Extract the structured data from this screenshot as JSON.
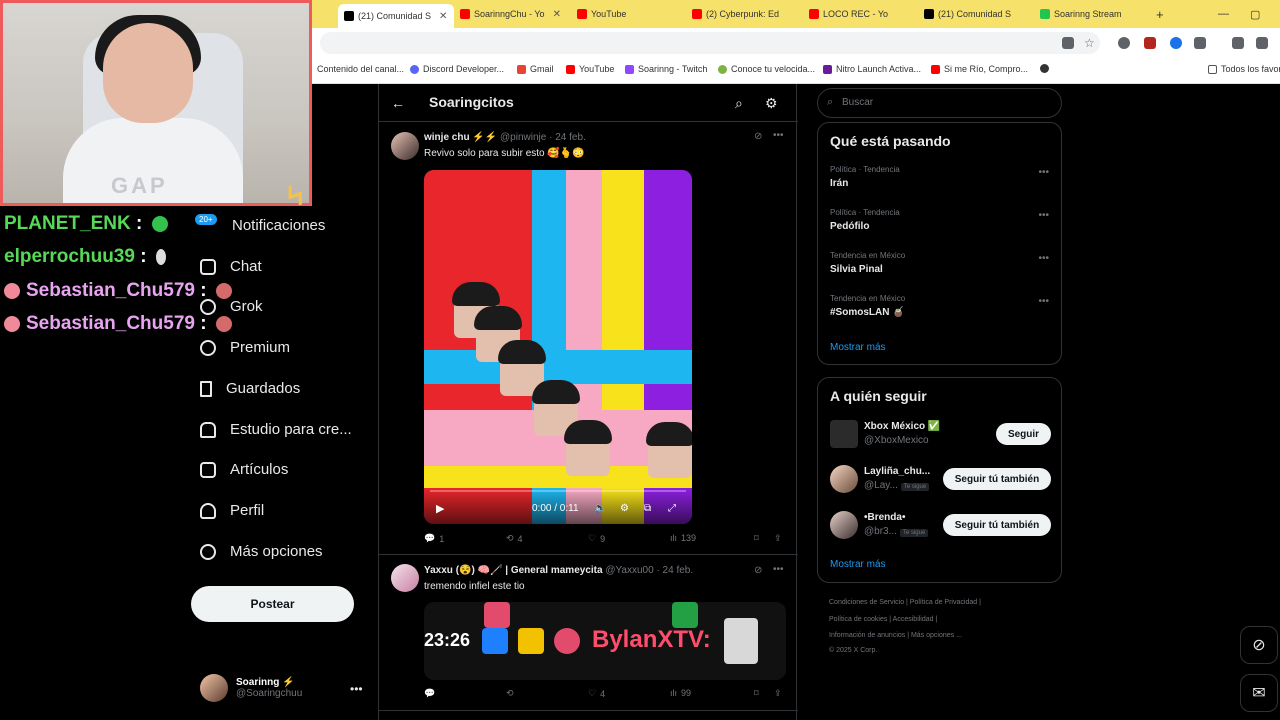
{
  "tabs": [
    {
      "label": "(21) Comunidad S",
      "color": "#000000",
      "active": true
    },
    {
      "label": "SoarinngChu - Yo",
      "color": "#ff0000"
    },
    {
      "label": "YouTube",
      "color": "#ff0000"
    },
    {
      "label": "(2) Cyberpunk: Ed",
      "color": "#ff0000"
    },
    {
      "label": "LOCO REC - Yo",
      "color": "#ff0000"
    },
    {
      "label": "(21) Comunidad S",
      "color": "#000000"
    },
    {
      "label": "Soarinng Stream",
      "color": "#23c552"
    }
  ],
  "bookmarks": [
    {
      "label": "Contenido del canal...",
      "color": "#ff0000"
    },
    {
      "label": "Discord Developer...",
      "color": "#5865f2"
    },
    {
      "label": "Gmail",
      "color": "#ea4335"
    },
    {
      "label": "YouTube",
      "color": "#ff0000"
    },
    {
      "label": "Soarinng - Twitch",
      "color": "#9146ff"
    },
    {
      "label": "Conoce tu velocida...",
      "color": "#7cb342"
    },
    {
      "label": "Nitro Launch Activa...",
      "color": "#6a1b9a"
    },
    {
      "label": "Si me Río, Compro...",
      "color": "#ff0000"
    },
    {
      "label": "Todos los favor",
      "color": "#555555"
    }
  ],
  "chat": [
    {
      "user": "PLANET_ENK",
      "style": "green"
    },
    {
      "user": "elperrochuu39",
      "style": "green"
    },
    {
      "user": "Sebastian_Chu579",
      "style": "pink"
    },
    {
      "user": "Sebastian_Chu579",
      "style": "pink"
    }
  ],
  "webcam_shirt": "GAP",
  "nav": {
    "badge": "20+",
    "items": [
      "Notificaciones",
      "Chat",
      "Grok",
      "Premium",
      "Guardados",
      "Estudio para cre...",
      "Artículos",
      "Perfil",
      "Más opciones"
    ],
    "post_label": "Postear"
  },
  "profile": {
    "name": "Soarinng ⚡",
    "handle": "@Soaringchuu"
  },
  "main": {
    "title": "Soaringcitos",
    "tweet1": {
      "name": "winje chu ⚡⚡",
      "meta": "@pinwinje · 24 feb.",
      "text": "Revivo solo para subir esto 🥰🫰😳",
      "video_time": "0:00 / 0:11",
      "replies": "1",
      "reposts": "4",
      "likes": "9",
      "views": "139"
    },
    "tweet2": {
      "name": "Yaxxu (😵) 🧠🦯 | General mameycita",
      "meta": "@Yaxxu00 · 24 feb.",
      "text": "tremendo infiel este tio",
      "embed_t1": "23:26",
      "embed_t2": "BylanXTV:",
      "likes": "4",
      "views": "99"
    }
  },
  "sidebar": {
    "search_placeholder": "Buscar",
    "trends_title": "Qué está pasando",
    "trends": [
      {
        "cat": "Política · Tendencia",
        "name": "Irán"
      },
      {
        "cat": "Política · Tendencia",
        "name": "Pedófilo"
      },
      {
        "cat": "Tendencia en México",
        "name": "Silvia Pinal"
      },
      {
        "cat": "Tendencia en México",
        "name": "#SomosLAN 🧉"
      }
    ],
    "show_more": "Mostrar más",
    "follow_title": "A quién seguir",
    "follows": [
      {
        "name": "Xbox México ✅",
        "handle": "@XboxMexico",
        "button": "Seguir",
        "tag": ""
      },
      {
        "name": "Layliña_chu...",
        "handle": "@Lay...",
        "button": "Seguir tú también",
        "tag": "Te sigue"
      },
      {
        "name": "•Brenda•",
        "handle": "@br3...",
        "button": "Seguir tú también",
        "tag": "Te sigue"
      }
    ],
    "footer": [
      "Condiciones de Servicio  |  Política de Privacidad  |",
      "Política de cookies  |  Accesibilidad  |",
      "Información de anuncios  |  Más opciones ...",
      "© 2025 X Corp."
    ]
  }
}
